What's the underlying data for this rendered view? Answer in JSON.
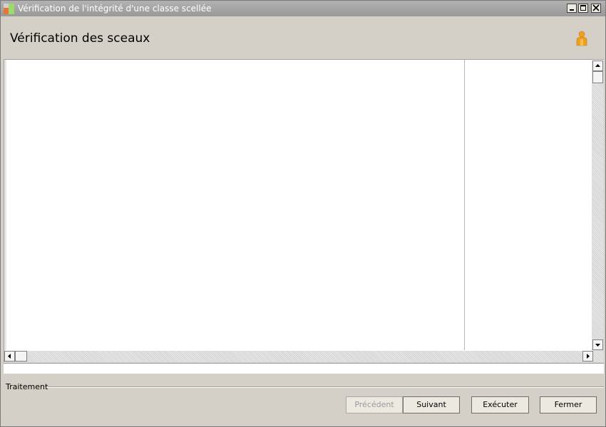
{
  "window": {
    "title": "Vérification de l'intégrité d'une classe scellée",
    "icon": "app-icon",
    "controls": [
      "minimize-icon",
      "maximize-icon",
      "close-icon"
    ]
  },
  "header": {
    "title": "Vérification des sceaux",
    "icon": "user-icon"
  },
  "main": {
    "left_pane_text": "",
    "right_pane_text": ""
  },
  "status": {
    "value": ""
  },
  "group": {
    "label": "Traitement"
  },
  "buttons": {
    "previous": {
      "label": "Précédent",
      "enabled": false
    },
    "next": {
      "label": "Suivant",
      "enabled": true
    },
    "execute": {
      "label": "Exécuter",
      "enabled": true
    },
    "close": {
      "label": "Fermer",
      "enabled": true
    }
  },
  "colors": {
    "titlebar": "#a8a8a8",
    "face": "#d4d0c8",
    "user_icon": "#f0a020"
  }
}
